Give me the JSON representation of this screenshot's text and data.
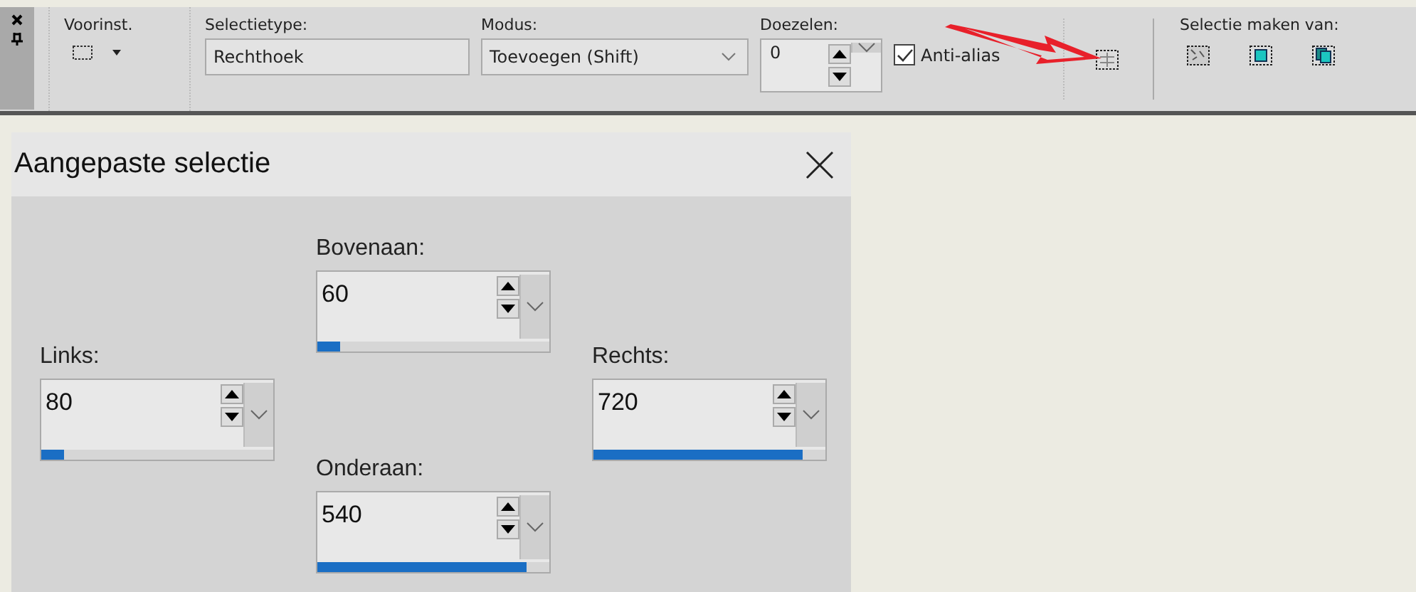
{
  "toolbar": {
    "preset": {
      "label": "Voorinst."
    },
    "selection_type": {
      "label": "Selectietype:",
      "value": "Rechthoek"
    },
    "mode": {
      "label": "Modus:",
      "value": "Toevoegen (Shift)"
    },
    "feather": {
      "label": "Doezelen:",
      "value": "0"
    },
    "antialias": {
      "label": "Anti-alias",
      "checked": true
    },
    "make_selection_from": {
      "label": "Selectie maken van:"
    }
  },
  "dialog": {
    "title": "Aangepaste selectie",
    "fields": [
      {
        "kind": "top",
        "label": "Bovenaan:",
        "value": "60",
        "level": 0.1
      },
      {
        "kind": "left",
        "label": "Links:",
        "value": "80",
        "level": 0.1
      },
      {
        "kind": "right",
        "label": "Rechts:",
        "value": "720",
        "level": 0.9
      },
      {
        "kind": "bottom",
        "label": "Onderaan:",
        "value": "540",
        "level": 0.9
      }
    ]
  }
}
